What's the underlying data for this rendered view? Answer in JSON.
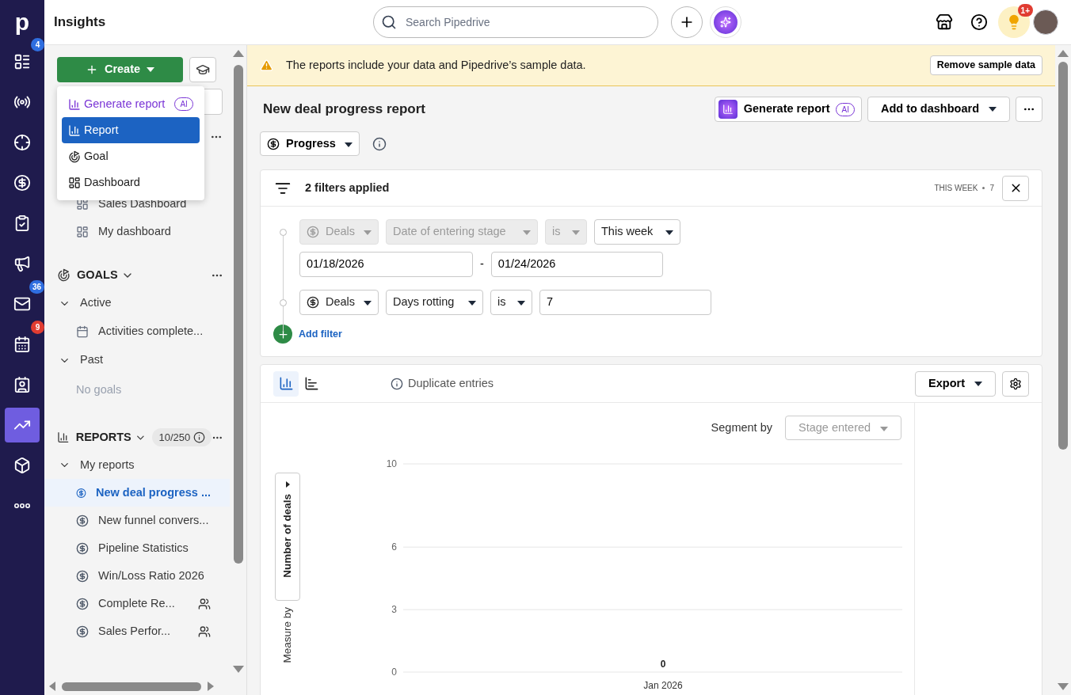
{
  "app": {
    "logo": "p",
    "title": "Insights"
  },
  "nav": [
    {
      "selected": false,
      "badge": {
        "text": "4",
        "color": "#2f6ee0"
      }
    },
    {
      "selected": false
    },
    {
      "selected": false
    },
    {
      "selected": false
    },
    {
      "selected": false
    },
    {
      "selected": false
    },
    {
      "selected": false,
      "badge": {
        "text": "36",
        "color": "#2f6ee0"
      }
    },
    {
      "selected": false,
      "badge": {
        "text": "9",
        "color": "#e03c31"
      }
    },
    {
      "selected": false
    },
    {
      "selected": true
    },
    {
      "selected": false
    },
    {
      "selected": false
    }
  ],
  "header": {
    "search": {
      "placeholder": "Search Pipedrive"
    },
    "tips_badge": "1+"
  },
  "sidebar": {
    "create_button": "Create",
    "create_menu": [
      {
        "kind": "ai",
        "label": "Generate report",
        "tag": "AI",
        "selected": false
      },
      {
        "kind": "report",
        "label": "Report",
        "selected": true
      },
      {
        "kind": "goal",
        "label": "Goal",
        "selected": false
      },
      {
        "kind": "dashboard",
        "label": "Dashboard",
        "selected": false
      }
    ],
    "dashboards": [
      "Sales Dashboard",
      "My dashboard"
    ],
    "goals": {
      "title": "GOALS",
      "groups": [
        {
          "label": "Active",
          "expanded": true,
          "items": [
            "Activities complete..."
          ]
        },
        {
          "label": "Past",
          "expanded": true,
          "empty": "No goals"
        }
      ]
    },
    "reports": {
      "title": "REPORTS",
      "count": "10/250",
      "group": "My reports",
      "items": [
        {
          "label": "New deal progress ...",
          "selected": true,
          "shared": false
        },
        {
          "label": "New funnel convers...",
          "selected": false,
          "shared": false
        },
        {
          "label": "Pipeline Statistics",
          "selected": false,
          "shared": false
        },
        {
          "label": "Win/Loss Ratio 2026",
          "selected": false,
          "shared": false
        },
        {
          "label": "Complete Re...",
          "selected": false,
          "shared": true
        },
        {
          "label": "Sales Perfor...",
          "selected": false,
          "shared": true
        }
      ]
    }
  },
  "banner": {
    "text": "The reports include your data and Pipedrive’s sample data.",
    "button": "Remove sample data"
  },
  "report": {
    "title": "New deal progress report",
    "generate_button": {
      "label": "Generate report",
      "tag": "AI"
    },
    "add_button": "Add to dashboard",
    "view": "Progress"
  },
  "filters": {
    "summary": "2 filters applied",
    "period": "THIS WEEK",
    "count": "7",
    "rows": [
      {
        "fields": [
          {
            "value": "Deals",
            "icon": true,
            "disabled": true
          },
          {
            "value": "Date of entering stage",
            "disabled": true
          },
          {
            "value": "is",
            "disabled": true
          },
          {
            "value": "This week",
            "disabled": false
          }
        ],
        "dates": [
          "01/18/2026",
          "01/24/2026"
        ],
        "separator": "-"
      },
      {
        "fields": [
          {
            "value": "Deals",
            "icon": true,
            "disabled": false
          },
          {
            "value": "Days rotting",
            "disabled": false
          },
          {
            "value": "is",
            "disabled": false
          }
        ],
        "input": "7"
      }
    ],
    "add_filter": "Add filter"
  },
  "chart_panel": {
    "toggles": [
      {
        "selected": true
      },
      {
        "selected": false
      }
    ],
    "duplicate": "Duplicate entries",
    "export": "Export",
    "segment_label": "Segment by",
    "segment_value": "Stage entered",
    "segment_disabled": true,
    "measure_label": "Measure by",
    "measure_value": "Number of deals",
    "chart_data": {
      "type": "bar",
      "categories": [
        "Jan 2026"
      ],
      "values": [
        0
      ],
      "ylim": [
        0,
        10
      ],
      "yticks": [
        0,
        3,
        6,
        10
      ],
      "data_labels": true
    }
  }
}
